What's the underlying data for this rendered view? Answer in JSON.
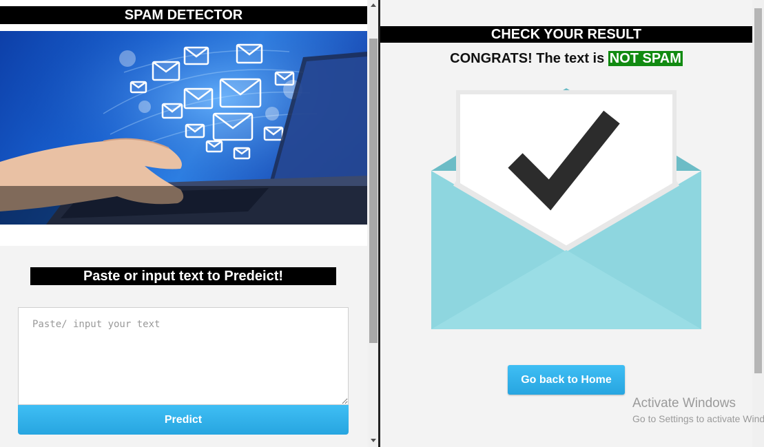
{
  "left": {
    "title": "SPAM DETECTOR",
    "prompt_heading": "Paste or input text to Predeict!",
    "text_placeholder": "Paste/ input your text",
    "predict_label": "Predict"
  },
  "right": {
    "title": "CHECK YOUR RESULT",
    "result_prefix": "CONGRATS! The text is",
    "result_value": "NOT SPAM",
    "home_label": "Go back to Home"
  },
  "watermark": {
    "title": "Activate Windows",
    "subtitle": "Go to Settings to activate Windows."
  },
  "colors": {
    "accent_blue": "#32b4ec",
    "result_badge": "#118a11",
    "bar_black": "#000000",
    "envelope_teal": "#8ed6df"
  },
  "icons": {
    "hero": "hand-laptop-email-illustration",
    "result": "envelope-checkmark-icon"
  }
}
